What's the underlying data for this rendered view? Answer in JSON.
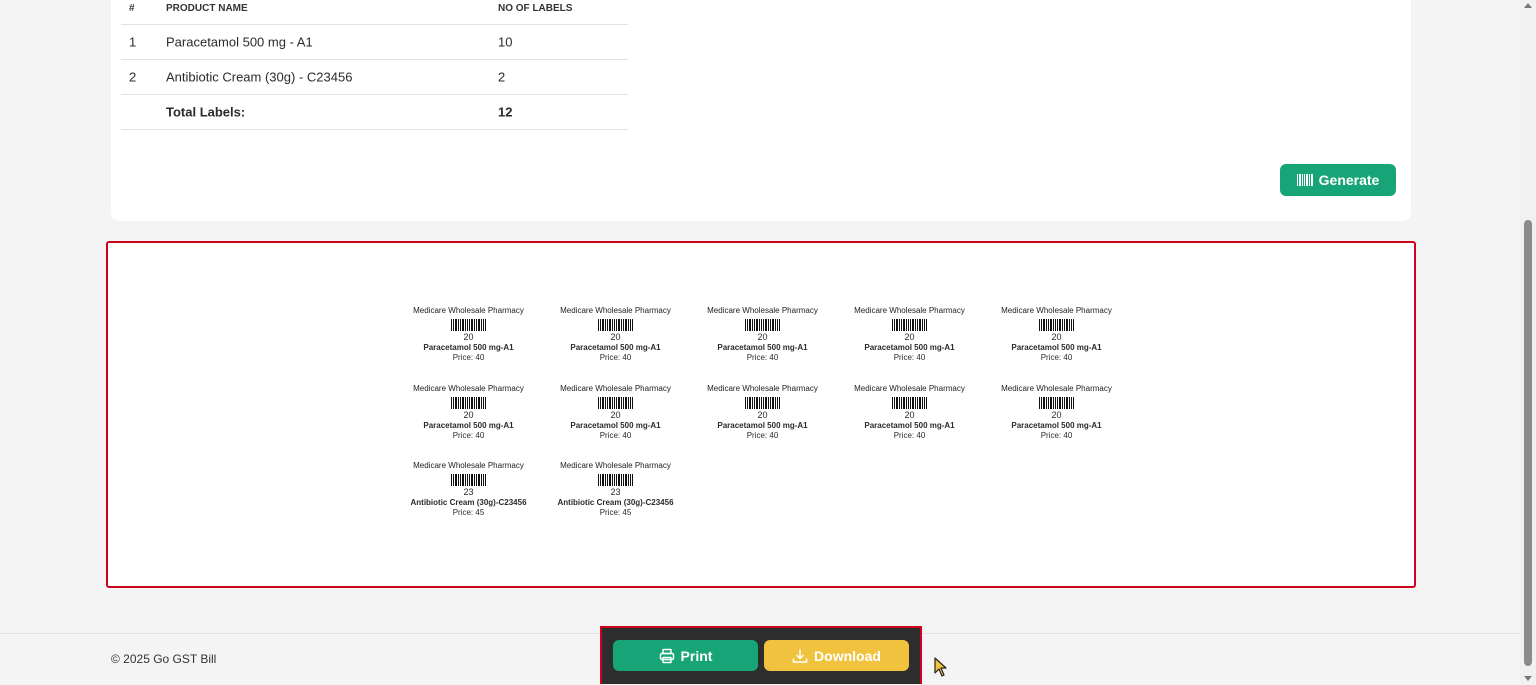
{
  "table": {
    "headers": [
      "#",
      "PRODUCT NAME",
      "NO OF LABELS"
    ],
    "rows": [
      {
        "index": "1",
        "name": "Paracetamol 500 mg - A1",
        "count": "10"
      },
      {
        "index": "2",
        "name": "Antibiotic Cream (30g) - C23456",
        "count": "2"
      }
    ],
    "total_label": "Total Labels:",
    "total_value": "12"
  },
  "generate_label": "Generate",
  "labels": [
    {
      "shop": "Medicare Wholesale Pharmacy",
      "code": "20",
      "product": "Paracetamol 500 mg-A1",
      "price": "Price: 40"
    },
    {
      "shop": "Medicare Wholesale Pharmacy",
      "code": "20",
      "product": "Paracetamol 500 mg-A1",
      "price": "Price: 40"
    },
    {
      "shop": "Medicare Wholesale Pharmacy",
      "code": "20",
      "product": "Paracetamol 500 mg-A1",
      "price": "Price: 40"
    },
    {
      "shop": "Medicare Wholesale Pharmacy",
      "code": "20",
      "product": "Paracetamol 500 mg-A1",
      "price": "Price: 40"
    },
    {
      "shop": "Medicare Wholesale Pharmacy",
      "code": "20",
      "product": "Paracetamol 500 mg-A1",
      "price": "Price: 40"
    },
    {
      "shop": "Medicare Wholesale Pharmacy",
      "code": "20",
      "product": "Paracetamol 500 mg-A1",
      "price": "Price: 40"
    },
    {
      "shop": "Medicare Wholesale Pharmacy",
      "code": "20",
      "product": "Paracetamol 500 mg-A1",
      "price": "Price: 40"
    },
    {
      "shop": "Medicare Wholesale Pharmacy",
      "code": "20",
      "product": "Paracetamol 500 mg-A1",
      "price": "Price: 40"
    },
    {
      "shop": "Medicare Wholesale Pharmacy",
      "code": "20",
      "product": "Paracetamol 500 mg-A1",
      "price": "Price: 40"
    },
    {
      "shop": "Medicare Wholesale Pharmacy",
      "code": "20",
      "product": "Paracetamol 500 mg-A1",
      "price": "Price: 40"
    },
    {
      "shop": "Medicare Wholesale Pharmacy",
      "code": "23",
      "product": "Antibiotic Cream (30g)-C23456",
      "price": "Price: 45"
    },
    {
      "shop": "Medicare Wholesale Pharmacy",
      "code": "23",
      "product": "Antibiotic Cream (30g)-C23456",
      "price": "Price: 45"
    }
  ],
  "footer": {
    "copyright": "© 2025 Go GST Bill"
  },
  "actions": {
    "print_label": "Print",
    "download_label": "Download"
  },
  "colors": {
    "primary": "#17a577",
    "warning": "#f1c23e",
    "highlight": "#d0021b"
  }
}
